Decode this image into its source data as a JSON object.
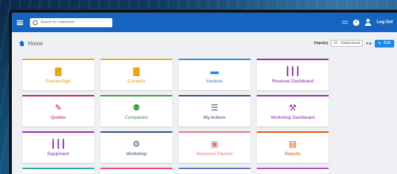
{
  "appbar": {
    "search_placeholder": "Search for code/name",
    "info_icon": "i",
    "logout_label": "Log Out"
  },
  "breadcrumb": {
    "title": "Home",
    "depot_label": "Depot(s)",
    "depot_value": "01 - Maidenhead",
    "edit_label": "Edit"
  },
  "tiles": [
    {
      "label": "CounterSign",
      "icon": "▇",
      "icon_name": "counter-sign-icon",
      "color": "#e6a817",
      "text_color": "#d89a00"
    },
    {
      "label": "Contacts",
      "icon": "▇",
      "icon_name": "contacts-icon",
      "color": "#e6a817",
      "text_color": "#d89a00"
    },
    {
      "label": "Invoices",
      "icon": "▬",
      "icon_name": "invoices-icon",
      "color": "#1e88e5",
      "text_color": "#1e6fc2"
    },
    {
      "label": "Revenue Dashboard",
      "icon": "┃┃┃",
      "icon_name": "revenue-chart-icon",
      "color": "#8e24aa",
      "text_color": "#7b1fa2"
    },
    {
      "label": "Quotes",
      "icon": "✎",
      "icon_name": "quotes-edit-icon",
      "color": "#c2185b",
      "text_color": "#b0104a"
    },
    {
      "label": "Companies",
      "icon": "⚉",
      "icon_name": "companies-icon",
      "color": "#2e9e45",
      "text_color": "#2e8b3f"
    },
    {
      "label": "My Actions",
      "icon": "☰",
      "icon_name": "my-actions-icon",
      "color": "#2b4d7a",
      "text_color": "#2b3f5c"
    },
    {
      "label": "Workshop Dashboard",
      "icon": "⚒",
      "icon_name": "workshop-dashboard-icon",
      "color": "#8e24aa",
      "text_color": "#7b1fa2"
    },
    {
      "label": "Equipment",
      "icon": "┃┃┃",
      "icon_name": "equipment-barcode-icon",
      "color": "#8e24aa",
      "text_color": "#7b1fa2"
    },
    {
      "label": "Workshop",
      "icon": "⚙",
      "icon_name": "workshop-gears-icon",
      "color": "#2b4d7a",
      "text_color": "#2b3f5c"
    },
    {
      "label": "Resource Planner",
      "icon": "▣",
      "icon_name": "resource-planner-icon",
      "color": "#e57373",
      "text_color": "#e57373"
    },
    {
      "label": "Reports",
      "icon": "▤",
      "icon_name": "reports-icon",
      "color": "#e65100",
      "text_color": "#d35400"
    }
  ],
  "peek_colors": [
    "#26a69a",
    "#ec407a",
    "#5c6bc0",
    "#ab47bc"
  ]
}
